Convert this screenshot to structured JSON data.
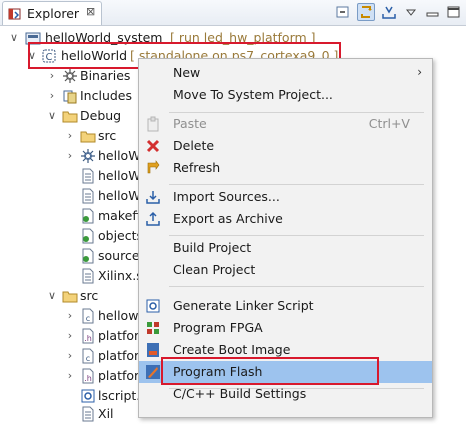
{
  "view": {
    "tab_label": "Explorer",
    "close_glyph": "⊠",
    "toolbar_icons": [
      "collapse-all-icon",
      "link-with-editor-icon",
      "filter-icon",
      "view-menu-icon",
      "minimize-icon",
      "maximize-icon"
    ]
  },
  "tree": {
    "system": {
      "name": "helloWorld_system",
      "decoration": "[ run led_hw_platform ]"
    },
    "app": {
      "name": "helloWorld",
      "decoration": "[ standalone on ps7_cortexa9_0 ]"
    },
    "items": [
      {
        "label": "Binaries",
        "icon": "binaries-icon"
      },
      {
        "label": "Includes",
        "icon": "includes-icon"
      },
      {
        "label": "Debug",
        "icon": "folder-icon"
      },
      {
        "label": "src",
        "icon": "folder-icon"
      },
      {
        "label": "helloWo",
        "icon": "gear-binary-icon"
      },
      {
        "label": "helloWo",
        "icon": "file-icon"
      },
      {
        "label": "helloWo",
        "icon": "file-icon"
      },
      {
        "label": "makefil",
        "icon": "makefile-icon"
      },
      {
        "label": "objects",
        "icon": "makefile-icon"
      },
      {
        "label": "sources",
        "icon": "makefile-icon"
      },
      {
        "label": "Xilinx.sp",
        "icon": "file-icon"
      },
      {
        "label": "src",
        "icon": "folder-icon"
      },
      {
        "label": "hellowo",
        "icon": "c-file-icon"
      },
      {
        "label": "platforn",
        "icon": "h-file-icon"
      },
      {
        "label": "platforn",
        "icon": "c-file-icon"
      },
      {
        "label": "platforn",
        "icon": "h-file-icon"
      },
      {
        "label": "lscript.l",
        "icon": "linker-script-icon"
      },
      {
        "label": "Xil",
        "icon": "file-icon"
      }
    ]
  },
  "menu": {
    "new": "New",
    "move_to_system": "Move To System Project...",
    "paste": "Paste",
    "paste_shortcut": "Ctrl+V",
    "delete": "Delete",
    "refresh": "Refresh",
    "import_sources": "Import Sources...",
    "export_archive": "Export as Archive",
    "build_project": "Build Project",
    "clean_project": "Clean Project",
    "generate_linker": "Generate Linker Script",
    "program_fpga": "Program FPGA",
    "create_boot": "Create Boot Image",
    "program_flash": "Program Flash",
    "cpp_build_settings": "C/C++ Build Settings"
  },
  "colors": {
    "highlight_box": "#d8192d",
    "menu_hover": "#9dc3ee"
  }
}
